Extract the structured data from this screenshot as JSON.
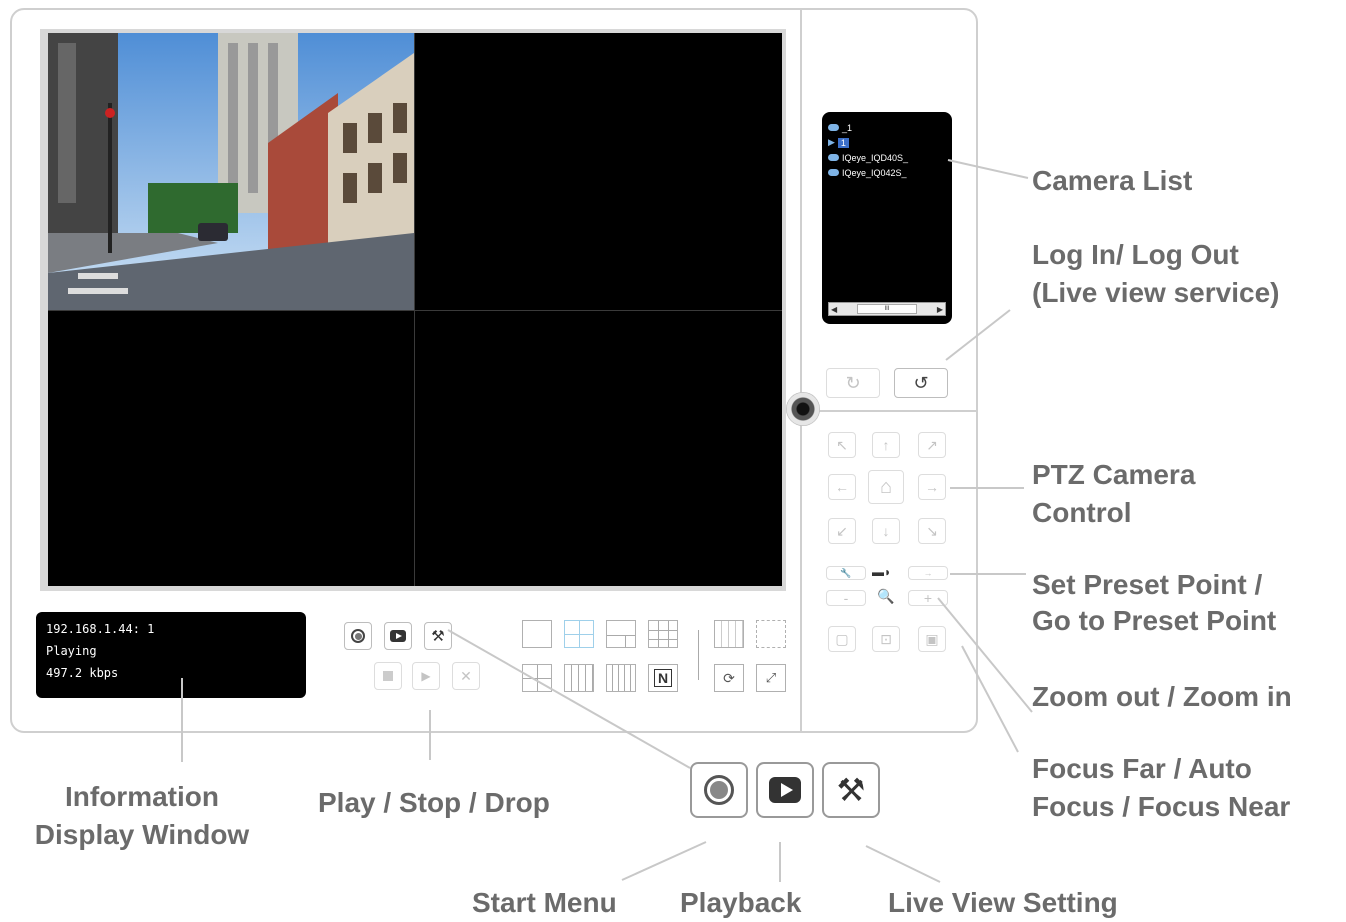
{
  "info_window": {
    "line1": "192.168.1.44: 1",
    "line2": "Playing",
    "line3": "497.2 kbps"
  },
  "camera_list": {
    "items": [
      {
        "label": "_1",
        "icon": "camera-icon"
      },
      {
        "label": "1",
        "icon": "play-icon",
        "selected": true
      },
      {
        "label": "IQeye_IQD40S_",
        "icon": "camera-icon"
      },
      {
        "label": "IQeye_IQ042S_",
        "icon": "camera-icon"
      }
    ],
    "scroll": "III"
  },
  "controls": {
    "start_menu_icon": "record-icon",
    "playback_icon": "playback-icon",
    "live_view_setting_icon": "tools-icon",
    "play_icon": "stop-icon",
    "step_icon": "play-step-icon",
    "drop_icon": "close-icon",
    "layouts": [
      "single",
      "quad",
      "six",
      "nine",
      "thirteen",
      "sixteen",
      "twenty-five",
      "n-split"
    ],
    "n_label": "N"
  },
  "callouts": {
    "camera_list": "Camera List",
    "login_1": "Log In/ Log Out",
    "login_2": "(Live view service)",
    "ptz_1": "PTZ Camera",
    "ptz_2": "Control",
    "preset_1": "Set Preset Point /",
    "preset_2": "Go to Preset Point",
    "zoom": "Zoom out / Zoom in",
    "focus_1": "Focus Far / Auto",
    "focus_2": "Focus / Focus Near",
    "info_1": "Information",
    "info_2": "Display Window",
    "play_stop": "Play / Stop / Drop",
    "start_menu": "Start Menu",
    "playback": "Playback",
    "live_view_setting": "Live View Setting"
  },
  "colors": {
    "frame": "#cfcfcf",
    "callout_text": "#6b6b6b",
    "camera_icon": "#7fb4e6",
    "active_layout": "#9fd0ea"
  }
}
